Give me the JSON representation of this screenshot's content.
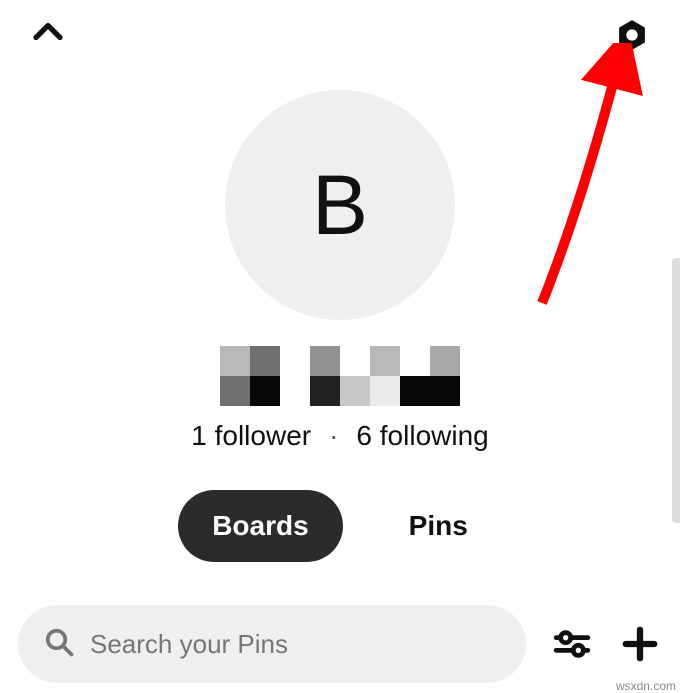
{
  "avatar_initial": "B",
  "stats": {
    "followers": "1 follower",
    "following": "6 following"
  },
  "tabs": {
    "boards": "Boards",
    "pins": "Pins"
  },
  "search": {
    "placeholder": "Search your Pins"
  },
  "watermark": "wsxdn.com",
  "username_pixels": [
    [
      "#b8b8b8",
      "#707070",
      "#ffffff",
      "#919191",
      "#ffffff",
      "#b8b8b8",
      "#ffffff",
      "#a9a9a9"
    ],
    [
      "#707070",
      "#080808",
      "#ffffff",
      "#222222",
      "#c8c8c8",
      "#eaeaea",
      "#080808",
      "#080808"
    ]
  ]
}
